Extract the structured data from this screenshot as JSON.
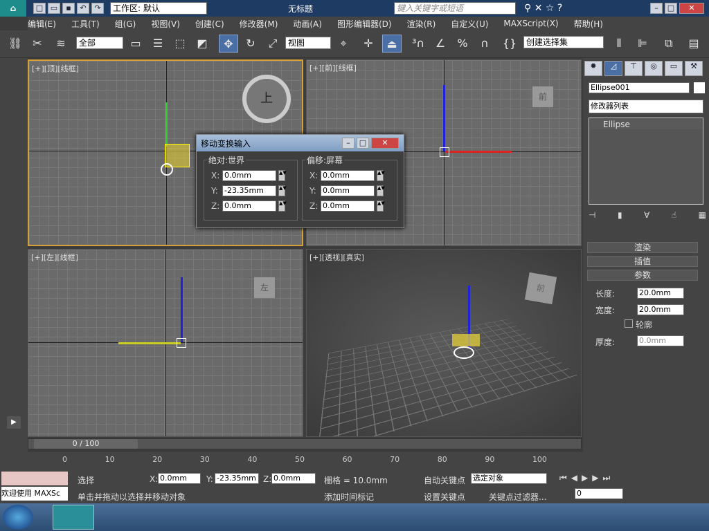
{
  "title_bar": {
    "workspace": "工作区: 默认",
    "doc_title": "无标题",
    "search_placeholder": "键入关键字或短语"
  },
  "menu": [
    "编辑(E)",
    "工具(T)",
    "组(G)",
    "视图(V)",
    "创建(C)",
    "修改器(M)",
    "动画(A)",
    "图形编辑器(D)",
    "渲染(R)",
    "自定义(U)",
    "MAXScript(X)",
    "帮助(H)"
  ],
  "toolbar": {
    "selection_filter": "全部",
    "ref_coord": "视图",
    "named_selection": "创建选择集"
  },
  "viewports": {
    "top": "[+][顶][线框]",
    "front": "[+][前][线框]",
    "left": "[+][左][线框]",
    "persp": "[+][透视][真实]"
  },
  "dialog": {
    "title": "移动变换输入",
    "abs_label": "绝对:世界",
    "off_label": "偏移:屏幕",
    "abs": {
      "x": "0.0mm",
      "y": "-23.35mm",
      "z": "0.0mm"
    },
    "off": {
      "x": "0.0mm",
      "y": "0.0mm",
      "z": "0.0mm"
    },
    "lx": "X:",
    "ly": "Y:",
    "lz": "Z:"
  },
  "cmd": {
    "object_name": "Ellipse001",
    "modifier_list": "修改器列表",
    "stack_item": "Ellipse",
    "rollouts": {
      "render": "渲染",
      "interp": "插值",
      "params": "参数"
    },
    "length_label": "长度:",
    "length": "20.0mm",
    "width_label": "宽度:",
    "width": "20.0mm",
    "outline_label": "轮廓",
    "thickness_label": "厚度:",
    "thickness": "0.0mm"
  },
  "timeline": {
    "frame": "0 / 100",
    "ticks": [
      "0",
      "10",
      "20",
      "30",
      "40",
      "50",
      "60",
      "70",
      "80",
      "90",
      "100"
    ]
  },
  "status": {
    "welcome": "欢迎使用 MAXSc",
    "sel": "选择",
    "x": "0.0mm",
    "y": "-23.35mm",
    "z": "0.0mm",
    "grid": "栅格 = 10.0mm",
    "prompt": "单击并拖动以选择并移动对象",
    "add_tag": "添加时间标记",
    "auto_key": "自动关键点",
    "set_key": "设置关键点",
    "sel_obj": "选定对象",
    "key_filter": "关键点过滤器...",
    "frame_field": "0"
  }
}
